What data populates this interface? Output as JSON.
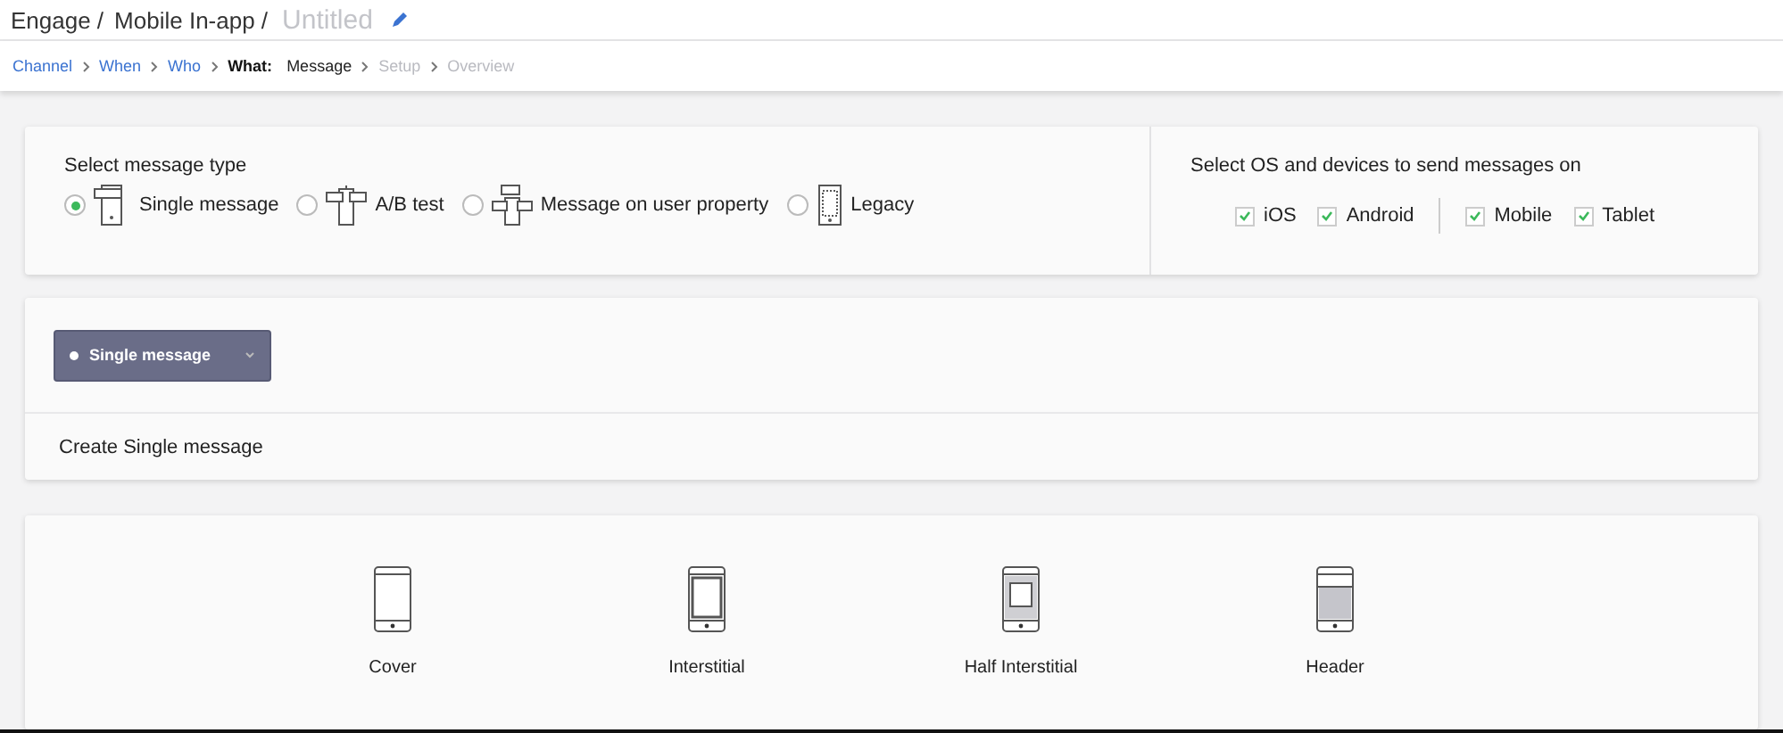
{
  "breadcrumb": [
    "Engage /",
    "Mobile In-app /"
  ],
  "title": "Untitled",
  "steps": [
    {
      "label": "Channel",
      "selected": false,
      "disabled": false
    },
    {
      "label": "When",
      "selected": false,
      "disabled": false
    },
    {
      "label": "Who",
      "selected": false,
      "disabled": false
    },
    {
      "prefix": "What:",
      "label": "Message",
      "selected": true,
      "disabled": false
    },
    {
      "label": "Setup",
      "selected": false,
      "disabled": true
    },
    {
      "label": "Overview",
      "selected": false,
      "disabled": true
    }
  ],
  "message_type": {
    "heading": "Select message type",
    "options": [
      {
        "label": "Single message",
        "kind": "single",
        "selected": true
      },
      {
        "label": "A/B test",
        "kind": "ab",
        "selected": false
      },
      {
        "label": "Message on user property",
        "kind": "property",
        "selected": false
      },
      {
        "label": "Legacy",
        "kind": "legacy",
        "selected": false
      }
    ]
  },
  "devices": {
    "heading": "Select OS and devices to send messages on",
    "groups": [
      [
        {
          "label": "iOS",
          "checked": true
        },
        {
          "label": "Android",
          "checked": true
        }
      ],
      [
        {
          "label": "Mobile",
          "checked": true
        },
        {
          "label": "Tablet",
          "checked": true
        }
      ]
    ]
  },
  "message_select": {
    "value": "Single message"
  },
  "section_title": "Create Single message",
  "templates": [
    {
      "label": "Cover",
      "kind": "cover"
    },
    {
      "label": "Interstitial",
      "kind": "interstitial"
    },
    {
      "label": "Half Interstitial",
      "kind": "half"
    },
    {
      "label": "Header",
      "kind": "header"
    }
  ]
}
